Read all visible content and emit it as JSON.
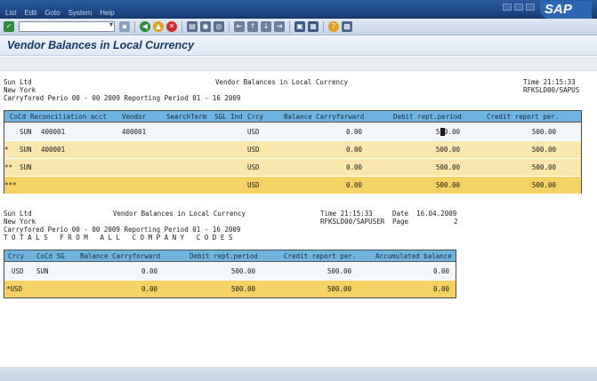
{
  "menu": [
    "List",
    "Edit",
    "Goto",
    "System",
    "Help"
  ],
  "logo": "SAP",
  "page_title": "Vendor Balances in Local Currency",
  "report1_header": {
    "company": "Sun Ltd",
    "city": "New York",
    "carry_line": "Carryfored Perio 00 - 00 2009 Reporting Period 01 - 16 2009",
    "center_title": "Vendor Balances in Local Currency",
    "time": "Time 21:15:33",
    "program": "RFKSLD00/SAPUS"
  },
  "table1": {
    "columns": [
      "CoCd",
      "Reconciliation acct",
      "Vendor",
      "SearchTerm",
      "SGL Ind",
      "Crcy",
      "Balance Carryforward",
      "Debit rept.period",
      "Credit report per."
    ],
    "rows": [
      {
        "mark": "",
        "cocd": "SUN",
        "recon": "400001",
        "vendor": "400001",
        "crcy": "USD",
        "balance": "0.00",
        "debit": "500.00",
        "credit": "500.00"
      },
      {
        "mark": "*",
        "cocd": "SUN",
        "recon": "400001",
        "vendor": "",
        "crcy": "USD",
        "balance": "0.00",
        "debit": "500.00",
        "credit": "500.00"
      },
      {
        "mark": "**",
        "cocd": "SUN",
        "recon": "",
        "vendor": "",
        "crcy": "USD",
        "balance": "0.00",
        "debit": "500.00",
        "credit": "500.00"
      },
      {
        "mark": "***",
        "cocd": "",
        "recon": "",
        "vendor": "",
        "crcy": "USD",
        "balance": "0.00",
        "debit": "500.00",
        "credit": "500.00"
      }
    ]
  },
  "report2_header": {
    "company": "Sun Ltd",
    "city": "New York",
    "carry_line": "Carryfored Perio 00 - 00 2009 Reporting Period 01 - 16 2009",
    "totals_line": "T O T A L S   F R O M   A L L   C O M P A N Y   C O D E S",
    "center_title": "Vendor Balances in Local Currency",
    "time": "Time 21:15:33",
    "date": "Date  16.04.2009",
    "program": "RFKSLD00/SAPUSER",
    "page_label": "Page",
    "page_no": "2"
  },
  "table2": {
    "columns": [
      "Crcy",
      "CoCd SG",
      "Balance Carryforward",
      "Debit rept.period",
      "Credit report per.",
      "Accumulated balance"
    ],
    "rows": [
      {
        "crcy": "USD",
        "cocd": "SUN",
        "balance": "0.00",
        "debit": "500.00",
        "credit": "500.00",
        "accum": "0.00"
      },
      {
        "crcy": "*USD",
        "cocd": "",
        "balance": "0.00",
        "debit": "500.00",
        "credit": "500.00",
        "accum": "0.00"
      }
    ]
  }
}
